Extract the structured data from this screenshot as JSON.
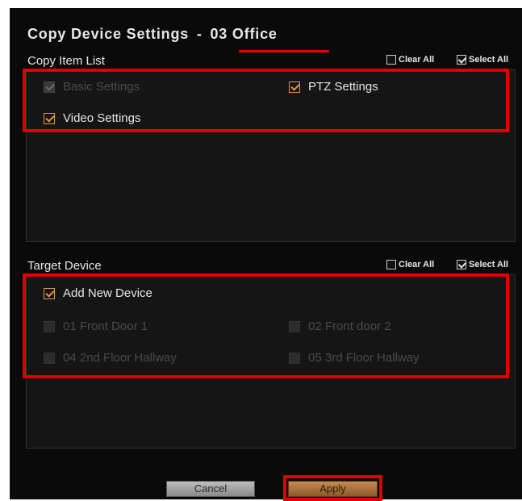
{
  "dialog": {
    "title": "Copy Device Settings",
    "title_separator": "-",
    "device_name": "03 Office"
  },
  "copy_items": {
    "label": "Copy Item List",
    "clear_all": "Clear All",
    "select_all": "Select All",
    "items": [
      {
        "label": "Basic Settings",
        "state": "disabled-checked"
      },
      {
        "label": "PTZ Settings",
        "state": "checked"
      },
      {
        "label": "Video Settings",
        "state": "checked"
      }
    ]
  },
  "target_device": {
    "label": "Target Device",
    "clear_all": "Clear All",
    "select_all": "Select All",
    "items": [
      {
        "label": "Add New Device",
        "state": "checked"
      },
      {
        "label": "01 Front Door 1",
        "state": "unchecked"
      },
      {
        "label": "02 Front door 2",
        "state": "unchecked"
      },
      {
        "label": "04 2nd Floor Hallway",
        "state": "unchecked"
      },
      {
        "label": "05 3rd Floor Hallway",
        "state": "unchecked"
      }
    ]
  },
  "buttons": {
    "cancel": "Cancel",
    "apply": "Apply"
  },
  "colors": {
    "highlight": "#e00000",
    "checkbox_accent": "#e09a40",
    "background": "#0a0a0a"
  }
}
